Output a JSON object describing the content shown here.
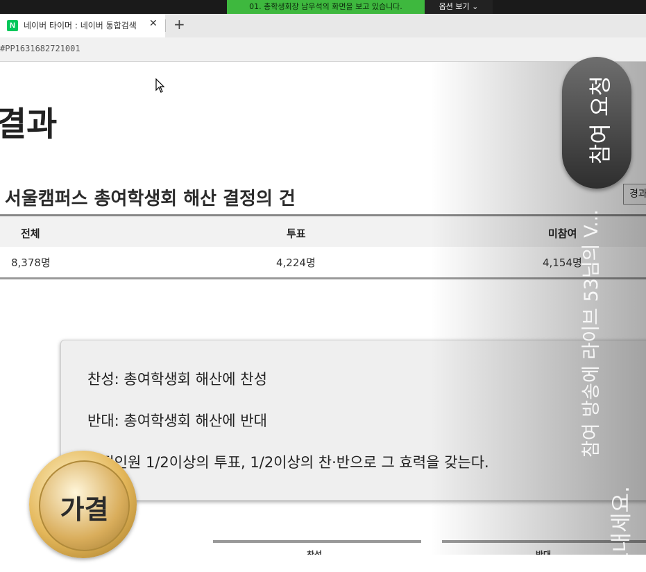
{
  "share_banner": {
    "message": "01. 총학생회장 남우석의 화면을 보고 있습니다.",
    "options_label": "옵션 보기 ⌄"
  },
  "browser": {
    "tab_title": "네이버 타이머 : 네이버 통합검색",
    "tab_close": "✕",
    "new_tab": "+",
    "url": "#PP1631682721001"
  },
  "page": {
    "title": "결과",
    "subtitle": ". 서울캠퍼스 총여학생회 해산 결정의 건",
    "side_button": "경과",
    "table": {
      "headers": [
        "전체",
        "투표",
        "미참여"
      ],
      "values": [
        "8,378명",
        "4,224명",
        "4,154명"
      ]
    },
    "info_lines": [
      "찬성: 총여학생회 해산에 찬성",
      "반대: 총여학생회 해산에 반대",
      "재적인원 1/2이상의 투표, 1/2이상의 찬·반으로 그 효력을 갖는다."
    ],
    "bottom_tabs": [
      "찬성",
      "반대"
    ],
    "medal": "가결"
  },
  "overlay": {
    "join_request": "참여 요청",
    "chat_text": "참여 방송에 라이브 53님의 V...",
    "chat_text_2": "보내세요."
  },
  "colors": {
    "banner": "#3eb83e",
    "naver": "#03c75a"
  }
}
